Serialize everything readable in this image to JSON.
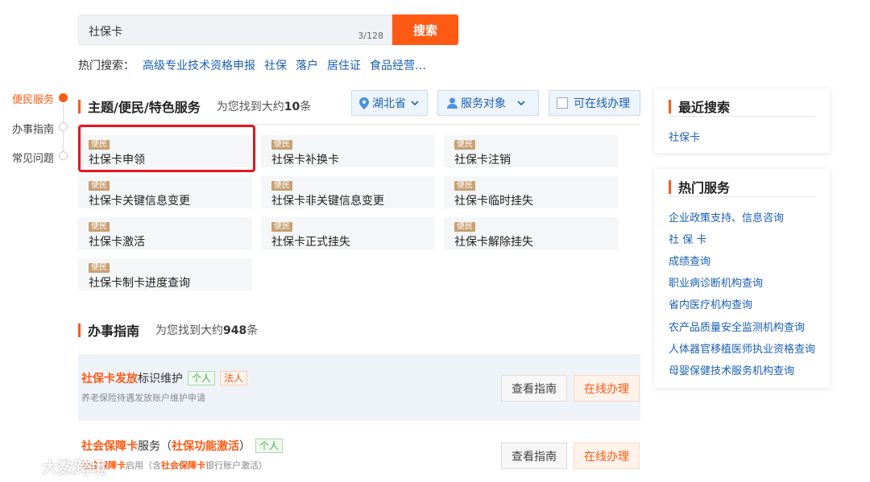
{
  "search": {
    "value": "社保卡",
    "count": "3/128",
    "button": "搜索"
  },
  "hot": {
    "label": "热门搜索：",
    "links": [
      "高级专业技术资格申报",
      "社保",
      "落户",
      "居住证",
      "食品经营…"
    ]
  },
  "left_nav": [
    "便民服务",
    "办事指南",
    "常见问题"
  ],
  "services": {
    "title": "主题/便民/特色服务",
    "count_prefix": "为您找到大约",
    "count": "10",
    "count_suffix": "条",
    "filters": {
      "region": "湖北省",
      "audience": "服务对象",
      "online": "可在线办理"
    },
    "tag": "便民",
    "cards": [
      "社保卡申领",
      "社保卡补换卡",
      "社保卡注销",
      "社保卡关键信息变更",
      "社保卡非关键信息变更",
      "社保卡临时挂失",
      "社保卡激活",
      "社保卡正式挂失",
      "社保卡解除挂失",
      "社保卡制卡进度查询"
    ]
  },
  "guides": {
    "title": "办事指南",
    "count_prefix": "为您找到大约",
    "count": "948",
    "count_suffix": "条",
    "items": [
      {
        "title_hl": "社保卡发放",
        "title_rest": "标识维护",
        "badges": [
          "个人",
          "法人"
        ],
        "subtitle": "养老保险待遇发放账户维护申请",
        "btn_guide": "查看指南",
        "btn_online": "在线办理"
      },
      {
        "title_hl": "社会保障卡",
        "title_mid": "服务（",
        "title_hl2": "社保功能激活",
        "title_end": "）",
        "badges": [
          "个人"
        ],
        "sub_hl": "社会保障卡",
        "sub_mid": "启用（含",
        "sub_hl2": "社会保障卡",
        "sub_end": "银行账户激活）",
        "btn_guide": "查看指南",
        "btn_online": "在线办理"
      }
    ]
  },
  "recent": {
    "title": "最近搜索",
    "items": [
      "社保卡"
    ]
  },
  "hot_services": {
    "title": "热门服务",
    "items": [
      "企业政策支持、信息咨询",
      "社 保 卡",
      "成绩查询",
      "职业病诊断机构查询",
      "省内医疗机构查询",
      "农产品质量安全监测机构查询",
      "人体器官移植医师执业资格查询",
      "母婴保健技术服务机构查询"
    ]
  },
  "watermark": "大数跨境",
  "colors": {
    "accent": "#ff5a14",
    "link": "#1a5fb4",
    "highlight_border": "#e8141e"
  }
}
